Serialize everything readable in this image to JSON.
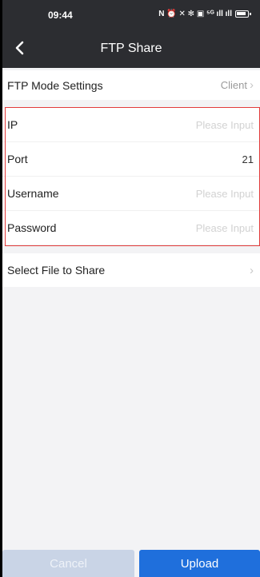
{
  "status_bar": {
    "time": "09:44",
    "icons": [
      "nfc-icon",
      "alarm-icon",
      "mute-icon",
      "bluetooth-icon",
      "hd-icon",
      "signal-5g-icon",
      "signal-icon",
      "battery-icon"
    ],
    "icon_text": "N ⏰ ✕ ✻ ▣ ⁵ᴳ ıll ıll"
  },
  "navbar": {
    "title": "FTP Share"
  },
  "settings": {
    "mode": {
      "label": "FTP Mode Settings",
      "value": "Client"
    },
    "fields": [
      {
        "label": "IP",
        "value": "",
        "placeholder": "Please Input"
      },
      {
        "label": "Port",
        "value": "21",
        "placeholder": ""
      },
      {
        "label": "Username",
        "value": "",
        "placeholder": "Please Input"
      },
      {
        "label": "Password",
        "value": "",
        "placeholder": "Please Input"
      }
    ],
    "share": {
      "label": "Select File to Share"
    }
  },
  "footer": {
    "cancel_label": "Cancel",
    "upload_label": "Upload"
  },
  "colors": {
    "header_bg": "#2c2d31",
    "primary": "#1f6fdc",
    "disabled": "#c9d4e6",
    "highlight_border": "#e23b3b"
  }
}
